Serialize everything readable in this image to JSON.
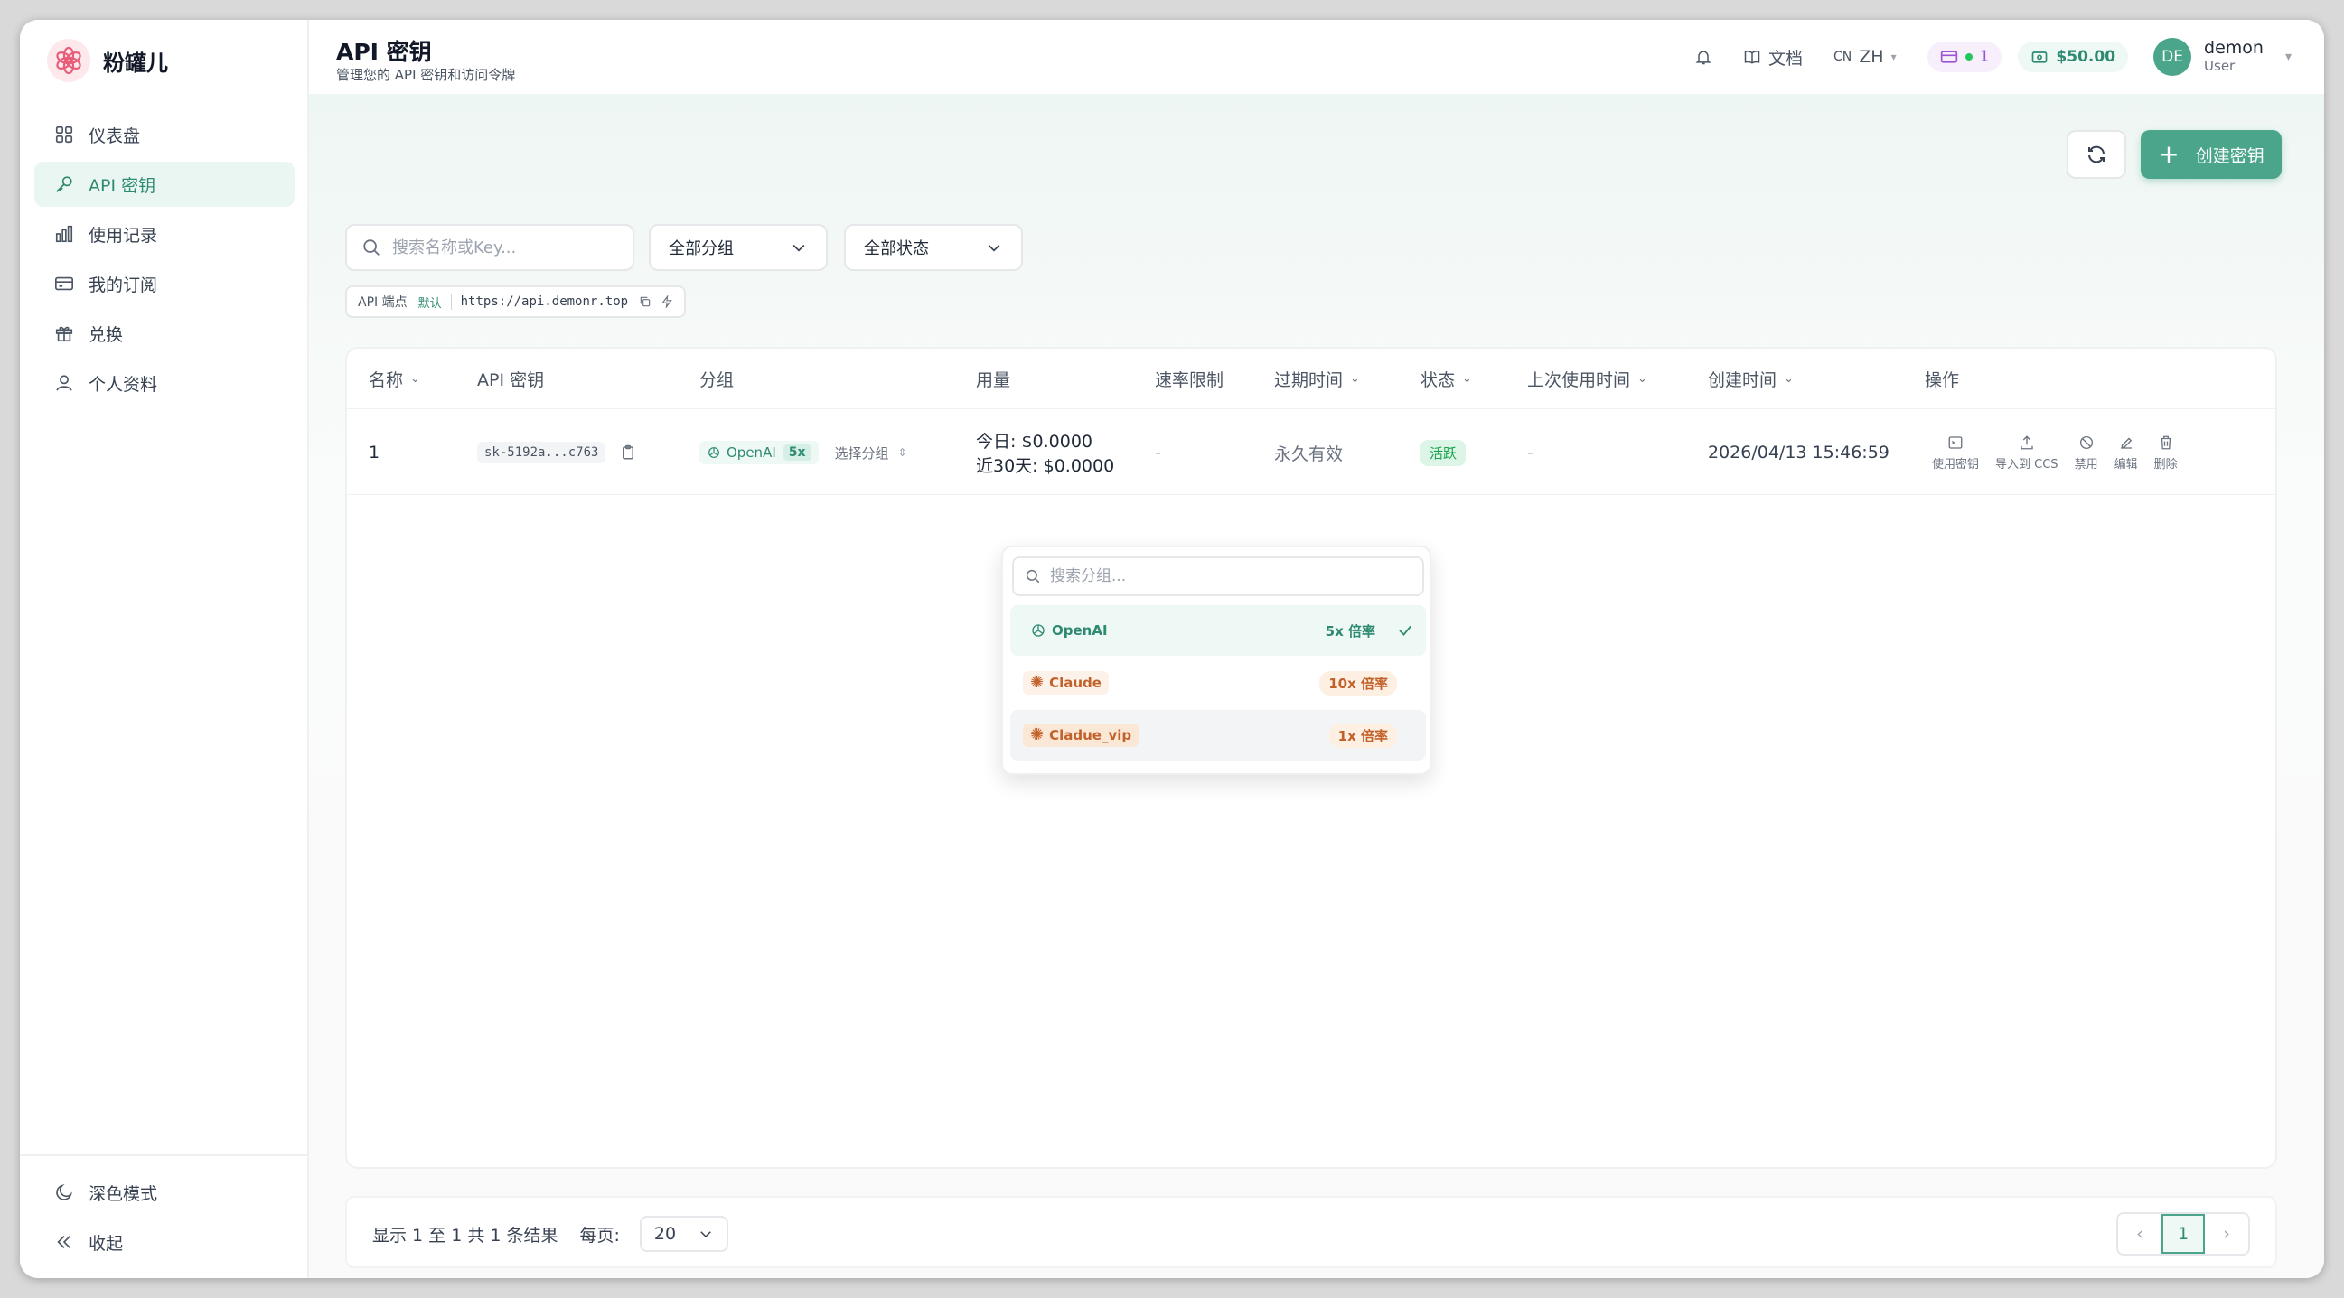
{
  "brand": {
    "name": "粉罐儿"
  },
  "sidebar": {
    "items": [
      {
        "label": "仪表盘",
        "icon": "dashboard-icon"
      },
      {
        "label": "API 密钥",
        "icon": "key-icon",
        "active": true
      },
      {
        "label": "使用记录",
        "icon": "chart-icon"
      },
      {
        "label": "我的订阅",
        "icon": "card-icon"
      },
      {
        "label": "兑换",
        "icon": "gift-icon"
      },
      {
        "label": "个人资料",
        "icon": "user-icon"
      }
    ],
    "dark_mode": "深色模式",
    "collapse": "收起"
  },
  "header": {
    "title": "API 密钥",
    "subtitle": "管理您的 API 密钥和访问令牌",
    "docs": "文档",
    "lang_code": "CN",
    "lang": "ZH",
    "sub_count": "1",
    "balance": "$50.00",
    "avatar": "DE",
    "user_name": "demon",
    "user_role": "User"
  },
  "toolbar": {
    "create": "创建密钥",
    "search_placeholder": "搜索名称或Key...",
    "group_filter": "全部分组",
    "status_filter": "全部状态"
  },
  "endpoint": {
    "label": "API 端点",
    "badge": "默认",
    "url": "https://api.demonr.top"
  },
  "table": {
    "columns": [
      "名称",
      "API 密钥",
      "分组",
      "用量",
      "速率限制",
      "过期时间",
      "状态",
      "上次使用时间",
      "创建时间",
      "操作"
    ],
    "rows": [
      {
        "name": "1",
        "key": "sk-5192a...c763",
        "group": "OpenAI",
        "group_mult": "5x",
        "select_group": "选择分组",
        "usage_today": "今日: $0.0000",
        "usage_30d": "近30天: $0.0000",
        "rate_limit": "-",
        "expires": "永久有效",
        "status": "活跃",
        "last_used": "-",
        "created": "2026/04/13 15:46:59",
        "actions": [
          "使用密钥",
          "导入到 CCS",
          "禁用",
          "编辑",
          "删除"
        ]
      }
    ]
  },
  "group_dropdown": {
    "search_placeholder": "搜索分组...",
    "options": [
      {
        "label": "OpenAI",
        "rate": "5x 倍率",
        "selected": true
      },
      {
        "label": "Claude",
        "rate": "10x 倍率"
      },
      {
        "label": "Cladue_vip",
        "rate": "1x 倍率"
      }
    ]
  },
  "pagination": {
    "summary": "显示 1 至 1 共 1 条结果",
    "per_page_label": "每页:",
    "per_page": "20",
    "current_page": "1"
  },
  "colors": {
    "accent": "#4aa58b",
    "accent_light": "#eaf6f2",
    "claude_orange": "#c2622b",
    "status_green": "#16a34a"
  }
}
